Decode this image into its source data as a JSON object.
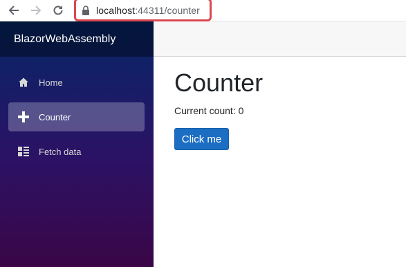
{
  "browser": {
    "url_host": "localhost",
    "url_rest": ":44311/counter"
  },
  "sidebar": {
    "brand": "BlazorWebAssembly",
    "items": [
      {
        "label": "Home",
        "icon": "home-icon"
      },
      {
        "label": "Counter",
        "icon": "plus-icon",
        "active": true
      },
      {
        "label": "Fetch data",
        "icon": "list-rich-icon"
      }
    ]
  },
  "main": {
    "title": "Counter",
    "count_label": "Current count: 0",
    "button_label": "Click me"
  },
  "colors": {
    "accent_button": "#1b6ec2",
    "address_highlight": "#d9484f",
    "sidebar_top": "#052767",
    "sidebar_bottom": "#3a0647"
  }
}
